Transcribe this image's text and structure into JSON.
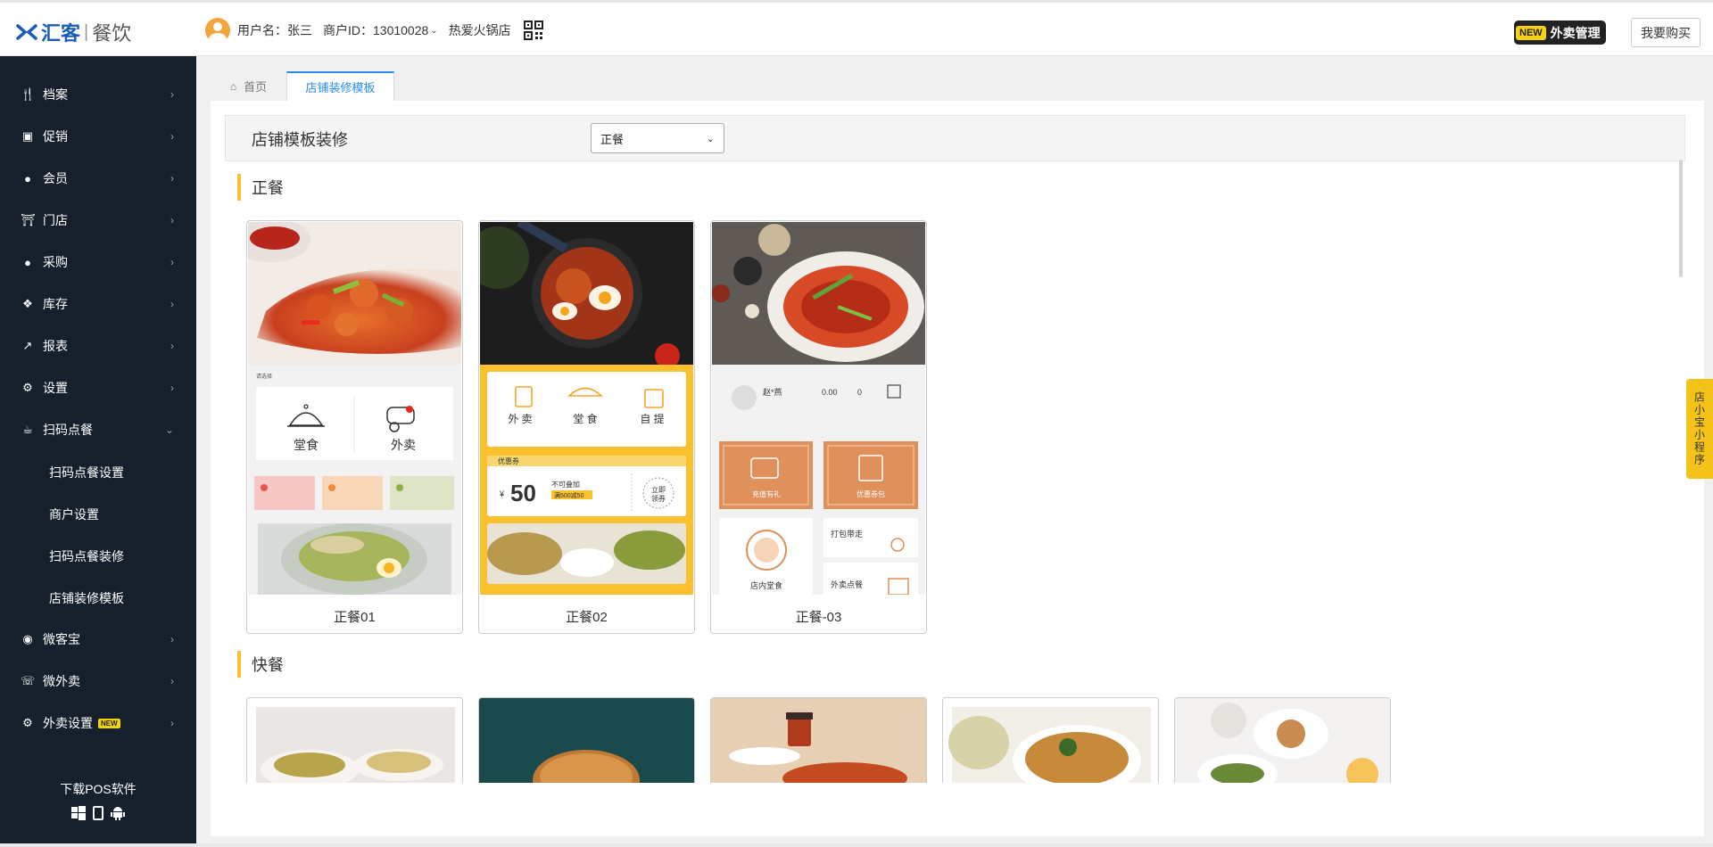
{
  "header": {
    "brand": "汇客",
    "brand_sub": "餐饮",
    "username": "用户名：张三",
    "merchant": "商户ID：13010028",
    "store": "热爱火锅店",
    "new_tag": "NEW",
    "takeaway_mgmt": "外卖管理",
    "buy": "我要购买"
  },
  "sidebar": {
    "items": [
      {
        "label": "档案",
        "icon": "cutlery-icon"
      },
      {
        "label": "促销",
        "icon": "gift-icon"
      },
      {
        "label": "会员",
        "icon": "users-icon"
      },
      {
        "label": "门店",
        "icon": "bank-icon"
      },
      {
        "label": "采购",
        "icon": "users-icon"
      },
      {
        "label": "库存",
        "icon": "cubes-icon"
      },
      {
        "label": "报表",
        "icon": "chart-icon"
      },
      {
        "label": "设置",
        "icon": "gear-icon"
      },
      {
        "label": "扫码点餐",
        "icon": "coffee-icon"
      }
    ],
    "sub_items": [
      "扫码点餐设置",
      "商户设置",
      "扫码点餐装修",
      "店铺装修模板"
    ],
    "items2": [
      {
        "label": "微客宝",
        "icon": "compass-icon"
      },
      {
        "label": "微外卖",
        "icon": "phone-icon"
      },
      {
        "label": "外卖设置",
        "icon": "cogs-icon",
        "badge": "NEW"
      }
    ],
    "download": "下载POS软件"
  },
  "tabs": {
    "home": "首页",
    "active": "店铺装修模板"
  },
  "toolbar": {
    "title": "店铺模板装修",
    "select_value": "正餐"
  },
  "sections": [
    {
      "title": "正餐",
      "cards": [
        "正餐01",
        "正餐02",
        "正餐-03"
      ]
    },
    {
      "title": "快餐"
    }
  ],
  "template_text": {
    "t1_select": "请选择",
    "t1_dine": "堂食",
    "t1_takeaway": "外卖",
    "t2_takeaway": "外 卖",
    "t2_dine": "堂 食",
    "t2_pickup": "自 提",
    "t2_coupon_title": "优惠券",
    "t2_amount": "50",
    "t2_no_stack": "不可叠加",
    "t2_rule": "满500减50",
    "t2_get": "立即领券",
    "t3_name": "赵*燕",
    "t3_points": "0.00",
    "t3_coupons": "0",
    "t3_recharge": "充值有礼",
    "t3_package": "优惠券包",
    "t3_pack": "打包带走",
    "t3_instore": "店内堂食",
    "t3_delivery": "外卖点餐"
  },
  "side_tab": "店小宝小程序",
  "colors": {
    "accent": "#2d8cf0",
    "sidebar_bg": "#161f2c",
    "yellow": "#fbc02d",
    "orange": "#e0905a"
  }
}
